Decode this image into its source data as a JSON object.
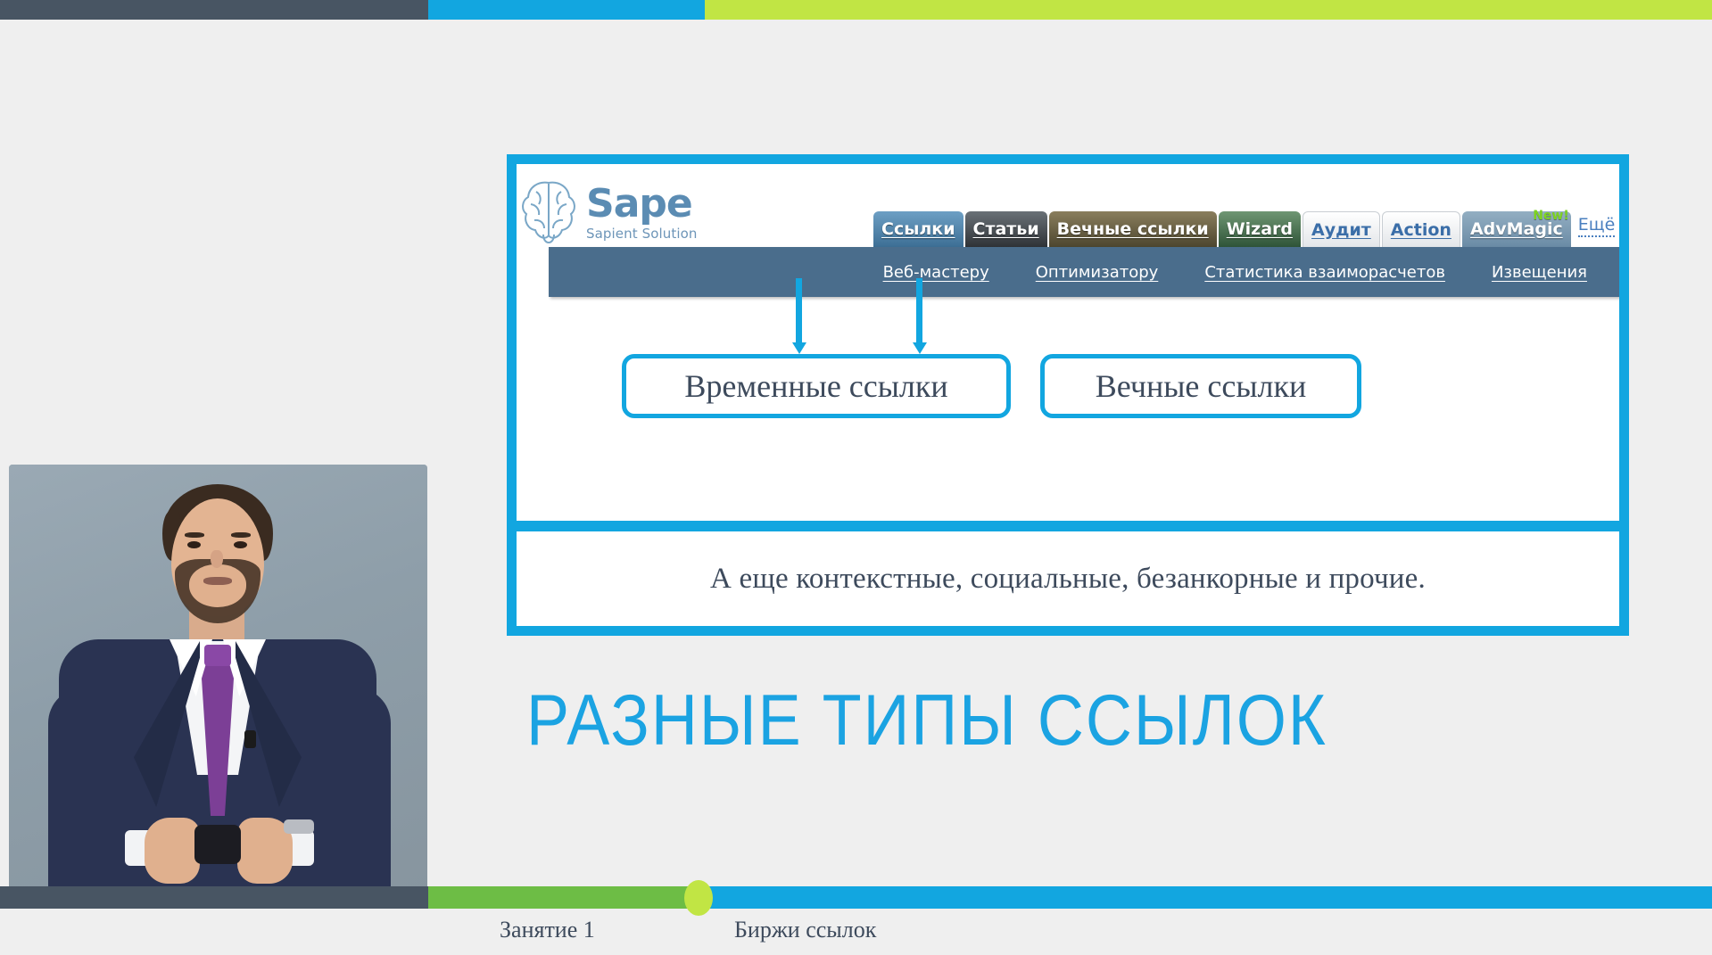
{
  "top_bar": {
    "segments": [
      {
        "name": "dark",
        "color": "#485563"
      },
      {
        "name": "blue",
        "color": "#12a6e0"
      },
      {
        "name": "lime",
        "color": "#c1e544"
      }
    ]
  },
  "presenter": {
    "alt": "presenter in navy suit with purple tie"
  },
  "screenshot_panel": {
    "site": {
      "logo_name": "Sape",
      "logo_tagline": "Sapient Solution",
      "tabs": [
        {
          "label": "Ссылки",
          "style": "links",
          "active": true,
          "badge": ""
        },
        {
          "label": "Статьи",
          "style": "dark",
          "active": false,
          "badge": ""
        },
        {
          "label": "Вечные ссылки",
          "style": "olive",
          "active": false,
          "badge": ""
        },
        {
          "label": "Wizard",
          "style": "green",
          "active": false,
          "badge": ""
        },
        {
          "label": "Аудит",
          "style": "white",
          "active": false,
          "badge": ""
        },
        {
          "label": "Action",
          "style": "white",
          "active": false,
          "badge": ""
        },
        {
          "label": "AdvMagic",
          "style": "steel",
          "active": false,
          "badge": "New!"
        }
      ],
      "more_label": "Ещё",
      "subnav": [
        {
          "label": "Веб-мастеру"
        },
        {
          "label": "Оптимизатору"
        },
        {
          "label": "Статистика взаиморасчетов"
        },
        {
          "label": "Извещения"
        }
      ]
    },
    "callouts": [
      {
        "label": "Временные ссылки"
      },
      {
        "label": "Вечные ссылки"
      }
    ],
    "caption": "А еще контекстные, социальные, безанкорные и прочие."
  },
  "slide": {
    "title": "РАЗНЫЕ ТИПЫ ССЫЛОК",
    "title_color": "#1ba3e2"
  },
  "footer": {
    "lesson": "Занятие 1",
    "topic": "Биржи ссылок"
  }
}
